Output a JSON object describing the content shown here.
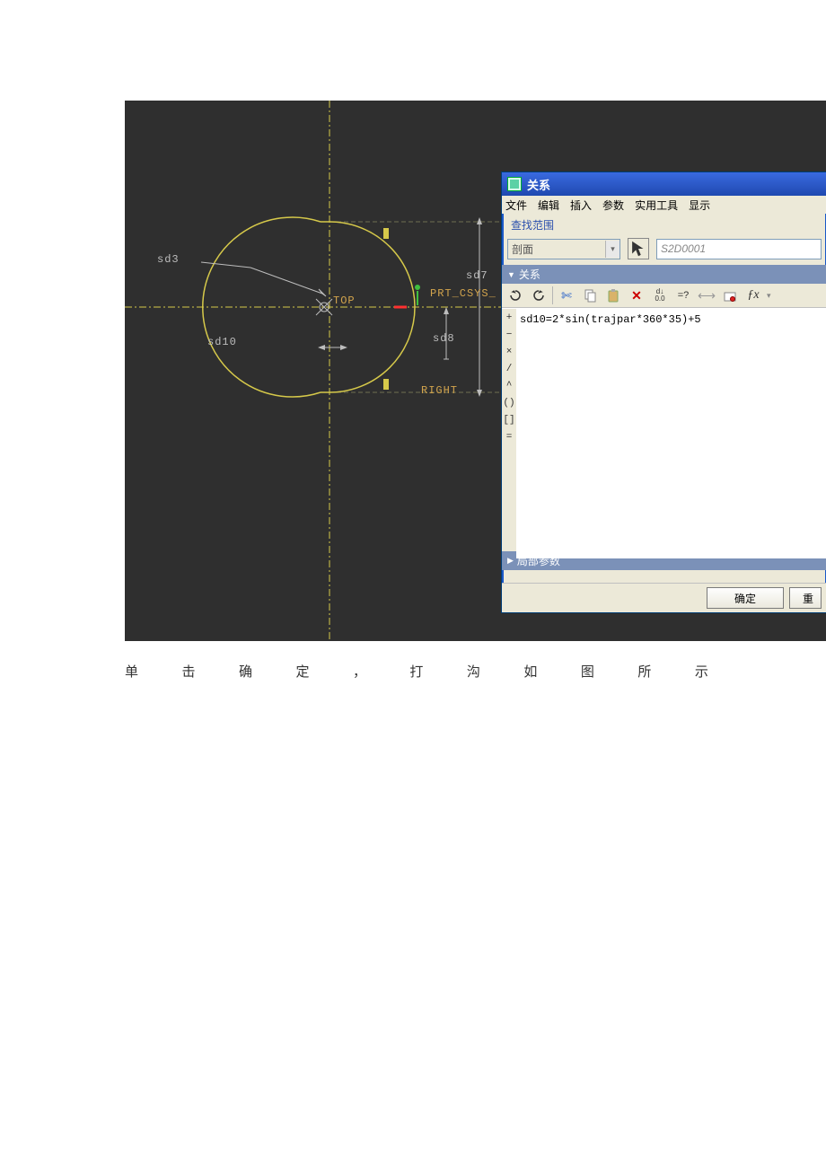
{
  "cad": {
    "labels": {
      "top": "TOP",
      "right": "RIGHT",
      "csys": "PRT_CSYS_"
    },
    "dims": {
      "sd3": "sd3",
      "sd7": "sd7",
      "sd8": "sd8",
      "sd10": "sd10"
    }
  },
  "dialog": {
    "title": "关系",
    "menu": {
      "file": "文件",
      "edit": "编辑",
      "insert": "插入",
      "params": "参数",
      "utils": "实用工具",
      "show": "显示"
    },
    "sections": {
      "scope": "查找范围",
      "relations": "关系",
      "local_params": "局部参数"
    },
    "scope": {
      "type": "剖面",
      "entity": "S2D0001"
    },
    "toolbar": {
      "undo": "↶",
      "redo": "↷",
      "cut": "✂",
      "copy": "⧉",
      "paste": "📋",
      "delete": "✕",
      "renum": "d/0.0",
      "eval": "=?",
      "dim": "⟷",
      "browse": "🗀",
      "fx": "ƒx"
    },
    "ops": [
      "+",
      "−",
      "×",
      "/",
      "^",
      "()",
      "[]",
      "="
    ],
    "code": "sd10=2*sin(trajpar*360*35)+5",
    "buttons": {
      "ok": "确定",
      "reset": "重"
    }
  },
  "caption": "单 击 确 定 ， 打 沟 如 图 所 示"
}
